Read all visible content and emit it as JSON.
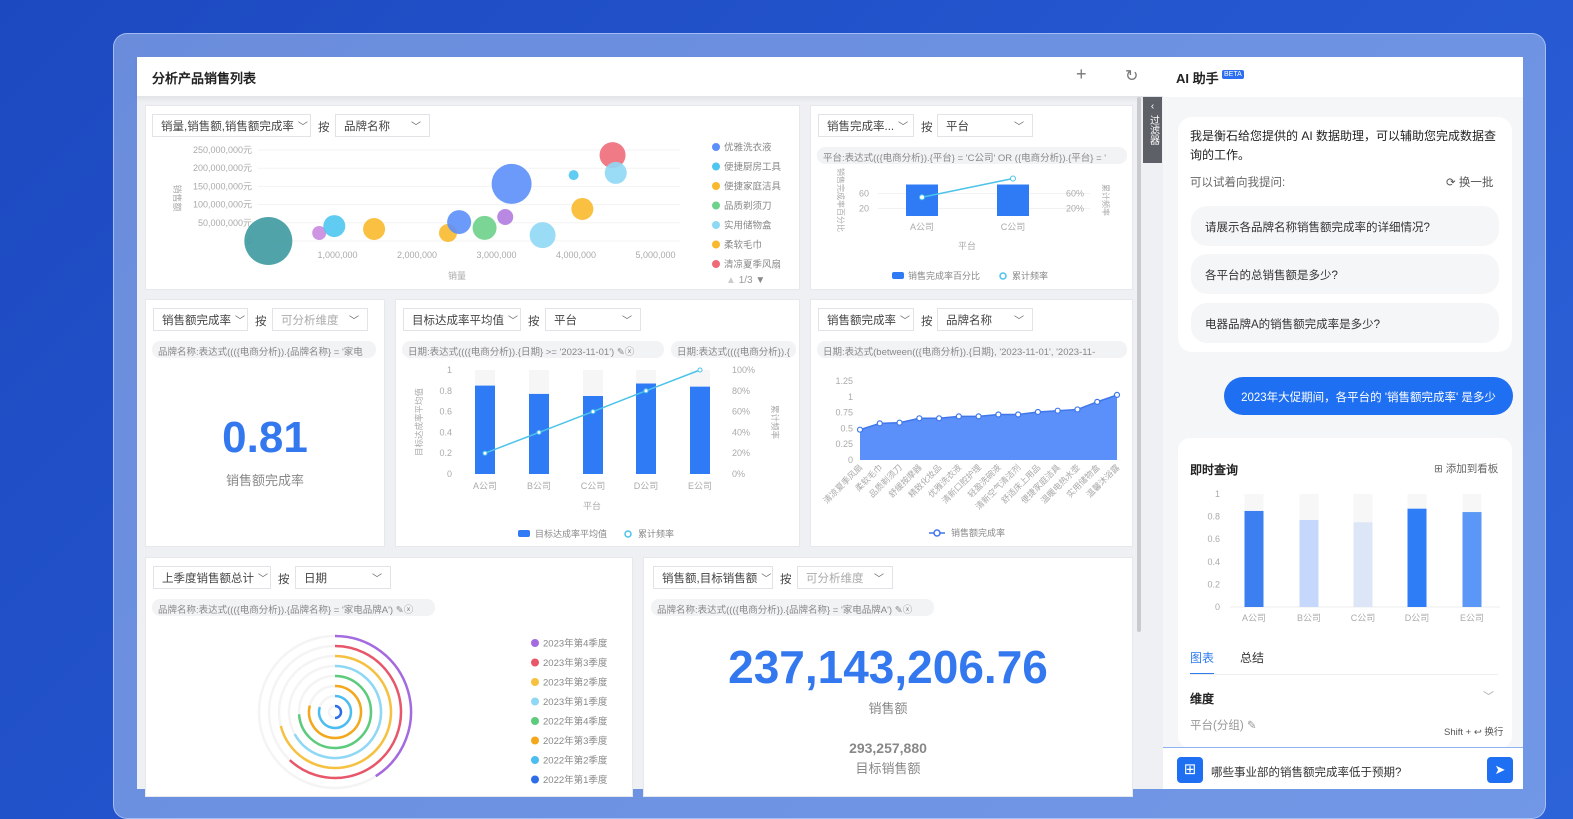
{
  "window": {
    "title": "分析产品销售列表",
    "add_icon": "plus-icon",
    "refresh_icon": "refresh-icon"
  },
  "filter_tab": "过滤器",
  "cards": {
    "bubble": {
      "metric": "销量,销售额,销售额完成率",
      "by": "按",
      "dimension": "品牌名称",
      "pager": "1/3"
    },
    "combo_top": {
      "metric": "销售完成率...",
      "by": "按",
      "dimension": "平台",
      "filter": "平台:表达式(({电商分析}).{平台} = 'C公司' OR ({电商分析}).{平台} = '"
    },
    "kpi_rate": {
      "metric": "销售额完成率",
      "by": "按",
      "dimension_placeholder": "可分析维度",
      "filter": "品牌名称:表达式((({电商分析}).{品牌名称} = '家电",
      "value": "0.81",
      "label": "销售额完成率"
    },
    "combo_mid": {
      "metric": "目标达成率平均值",
      "by": "按",
      "dimension": "平台",
      "filter1": "日期:表达式((({电商分析}).{日期} >= '2023-11-01')",
      "filter2": "日期:表达式((({电商分析}).{"
    },
    "area": {
      "metric": "销售额完成率",
      "by": "按",
      "dimension": "品牌名称",
      "filter": "日期:表达式(between(({电商分析}).{日期}, '2023-11-01', '2023-11-"
    },
    "radial": {
      "metric": "上季度销售额总计",
      "by": "按",
      "dimension": "日期",
      "filter": "品牌名称:表达式((({电商分析}).{品牌名称} = '家电品牌A')"
    },
    "kpi_sales": {
      "metric": "销售额,目标销售额",
      "by": "按",
      "dimension_placeholder": "可分析维度",
      "filter": "品牌名称:表达式((({电商分析}).{品牌名称} = '家电品牌A')",
      "value": "237,143,206.76",
      "label": "销售额",
      "sub_value": "293,257,880",
      "sub_label": "目标销售额"
    }
  },
  "ai": {
    "title": "AI 助手",
    "badge": "BETA",
    "welcome": "我是衡石给您提供的 AI 数据助理，可以辅助您完成数据查询的工作。",
    "try_label": "可以试着向我提问:",
    "refresh_label": "换一批",
    "suggestions": [
      "请展示各品牌名称销售额完成率的详细情况?",
      "各平台的总销售额是多少?",
      "电器品牌A的销售额完成率是多少?"
    ],
    "user_message": "2023年大促期间，各平台的 '销售额完成率' 是多少",
    "result_title": "即时查询",
    "add_to_board": "添加到看板",
    "tabs": [
      "图表",
      "总结"
    ],
    "active_tab": "图表",
    "section": "维度",
    "dimension_item": "平台(分组)",
    "hint": "Shift + ↩ 换行",
    "input_value": "哪些事业部的销售额完成率低于预期?",
    "accent": "#1f6ff2"
  },
  "chart_data": [
    {
      "type": "scatter",
      "xlabel": "销量",
      "ylabel": "销售额",
      "x_ticks": [
        "1,000,000",
        "2,000,000",
        "3,000,000",
        "4,000,000",
        "5,000,000"
      ],
      "y_ticks": [
        "0",
        "50,000,000元",
        "100,000,000元",
        "150,000,000元",
        "200,000,000元",
        "250,000,000元"
      ],
      "xlim": [
        0,
        5000000
      ],
      "ylim": [
        0,
        250000000
      ],
      "legend": [
        {
          "name": "优雅洗衣液",
          "color": "#5b8ff9"
        },
        {
          "name": "便捷厨房工具",
          "color": "#4fc6ef"
        },
        {
          "name": "便捷家庭洁具",
          "color": "#f8b92e"
        },
        {
          "name": "品质剃须刀",
          "color": "#6dd28a"
        },
        {
          "name": "实用储物盒",
          "color": "#8fd8f5"
        },
        {
          "name": "柔软毛巾",
          "color": "#f8b92e"
        },
        {
          "name": "清凉夏季风扇",
          "color": "#ef6b7a"
        }
      ],
      "legend_position": "right",
      "points": [
        {
          "x": 130000,
          "y": 0,
          "size": 24,
          "color": "#3d9aa0"
        },
        {
          "x": 770000,
          "y": 22000000,
          "size": 7,
          "color": "#c98ae0"
        },
        {
          "x": 960000,
          "y": 41000000,
          "size": 11,
          "color": "#4fc6ef"
        },
        {
          "x": 1460000,
          "y": 33000000,
          "size": 11,
          "color": "#f8b92e"
        },
        {
          "x": 2390000,
          "y": 22000000,
          "size": 9,
          "color": "#f8b92e"
        },
        {
          "x": 2530000,
          "y": 52000000,
          "size": 12,
          "color": "#5b8ff9"
        },
        {
          "x": 2850000,
          "y": 36000000,
          "size": 12,
          "color": "#6dd28a"
        },
        {
          "x": 3110000,
          "y": 66000000,
          "size": 8,
          "color": "#b17be0"
        },
        {
          "x": 3580000,
          "y": 16000000,
          "size": 13,
          "color": "#8fd8f5"
        },
        {
          "x": 3190000,
          "y": 157000000,
          "size": 20,
          "color": "#5b8ff9"
        },
        {
          "x": 3970000,
          "y": 181000000,
          "size": 5,
          "color": "#4fc6ef"
        },
        {
          "x": 4080000,
          "y": 88000000,
          "size": 11,
          "color": "#f8b92e"
        },
        {
          "x": 4460000,
          "y": 236000000,
          "size": 13,
          "color": "#ef6b7a"
        },
        {
          "x": 4500000,
          "y": 187000000,
          "size": 11,
          "color": "#8fd8f5"
        }
      ]
    },
    {
      "type": "bar",
      "categories": [
        "A公司",
        "C公司"
      ],
      "series": [
        {
          "name": "销售完成率百分比",
          "type": "bar",
          "values": [
            84,
            84
          ],
          "color": "#2f7bf5"
        },
        {
          "name": "累计频率",
          "type": "line",
          "values": [
            50,
            100
          ],
          "color": "#4cc3e8"
        }
      ],
      "xlabel": "平台",
      "ylabel": "销售完成率百分比",
      "y2label": "累计频率",
      "y_ticks": [
        "20",
        "60"
      ],
      "y2_ticks": [
        "20%",
        "60%"
      ],
      "legend_position": "bottom"
    },
    {
      "type": "bar",
      "categories": [
        "A公司",
        "B公司",
        "C公司",
        "D公司",
        "E公司"
      ],
      "series": [
        {
          "name": "目标达成率平均值",
          "type": "bar",
          "values": [
            0.85,
            0.77,
            0.75,
            0.87,
            0.84
          ],
          "color": "#2f7bf5"
        },
        {
          "name": "累计频率",
          "type": "line",
          "values": [
            20,
            40,
            60,
            80,
            100
          ],
          "color": "#4cc3e8"
        }
      ],
      "xlabel": "平台",
      "ylabel": "目标达成率平均值",
      "y2label": "累计频率",
      "ylim": [
        0,
        1
      ],
      "y2lim": [
        0,
        100
      ],
      "y_ticks": [
        "0",
        "0.2",
        "0.4",
        "0.6",
        "0.8",
        "1"
      ],
      "y2_ticks": [
        "0%",
        "20%",
        "40%",
        "60%",
        "80%",
        "100%"
      ],
      "legend_position": "bottom"
    },
    {
      "type": "area",
      "categories": [
        "清凉夏季风扇",
        "柔软毛巾",
        "品质剃须刀",
        "舒缓按摩器",
        "精致化妆品",
        "优雅洗衣液",
        "清新口腔护理",
        "轻盈洗碗液",
        "清新空气清洁剂",
        "舒适床上用品",
        "便捷家庭洁具",
        "温暖电热水壶",
        "实用储物盒",
        "温馨沐浴露"
      ],
      "series": [
        {
          "name": "销售额完成率",
          "values": [
            0.48,
            0.58,
            0.59,
            0.66,
            0.66,
            0.69,
            0.69,
            0.72,
            0.72,
            0.76,
            0.78,
            0.8,
            0.92,
            1.03
          ],
          "color": "#5b8ff9"
        }
      ],
      "ylim": [
        0,
        1.25
      ],
      "y_ticks": [
        "0",
        "0.25",
        "0.5",
        "0.75",
        "1",
        "1.25"
      ],
      "legend_position": "bottom"
    },
    {
      "type": "pie",
      "subtype": "radial-bar",
      "series": [
        {
          "name": "2023年第4季度",
          "value": 0.41,
          "color": "#a46be0"
        },
        {
          "name": "2023年第3季度",
          "value": 0.62,
          "color": "#e8566a"
        },
        {
          "name": "2023年第2季度",
          "value": 0.71,
          "color": "#f6c140"
        },
        {
          "name": "2023年第1季度",
          "value": 0.67,
          "color": "#8fd8f5"
        },
        {
          "name": "2022年第4季度",
          "value": 0.74,
          "color": "#5ccb7b"
        },
        {
          "name": "2022年第3季度",
          "value": 0.79,
          "color": "#f3a81b"
        },
        {
          "name": "2022年第2季度",
          "value": 0.8,
          "color": "#4cbdf0"
        },
        {
          "name": "2022年第1季度",
          "value": 0.5,
          "color": "#2d6ee8"
        }
      ],
      "legend_position": "right"
    },
    {
      "type": "bar",
      "categories": [
        "A公司",
        "B公司",
        "C公司",
        "D公司",
        "E公司"
      ],
      "values": [
        0.85,
        0.77,
        0.75,
        0.87,
        0.84
      ],
      "colors": [
        "#3b7ff0",
        "#c5d8fb",
        "#dde6f7",
        "#2e7cf6",
        "#5a97f6"
      ],
      "ylim": [
        0,
        1
      ],
      "y_ticks": [
        "0",
        "0.2",
        "0.4",
        "0.6",
        "0.8",
        "1"
      ]
    }
  ]
}
